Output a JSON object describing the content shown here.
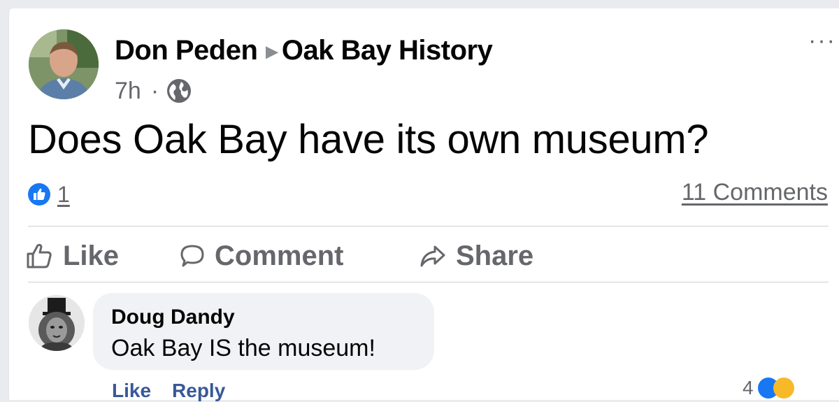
{
  "post": {
    "author": "Don Peden",
    "group": "Oak Bay History",
    "time": "7h",
    "separator": "·",
    "text": "Does Oak Bay have its own museum?",
    "reaction_count": "1",
    "comments_count": "11 Comments",
    "more_symbol": "···"
  },
  "actions": {
    "like_label": "Like",
    "comment_label": "Comment",
    "share_label": "Share"
  },
  "comment": {
    "author": "Doug Dandy",
    "text": "Oak Bay IS the museum!",
    "like_label": "Like",
    "reply_label": "Reply",
    "reaction_count": "4"
  },
  "colors": {
    "like_blue": "#1877f2",
    "text_primary": "#050505",
    "text_secondary": "#65676b",
    "comment_link": "#385898",
    "bubble": "#f0f2f5"
  },
  "icons": {
    "privacy": "globe-icon",
    "reaction": "like-reaction-icon",
    "like": "thumbs-up-icon",
    "comment": "speech-bubble-icon",
    "share": "share-arrow-icon",
    "more": "more-dots-icon"
  }
}
